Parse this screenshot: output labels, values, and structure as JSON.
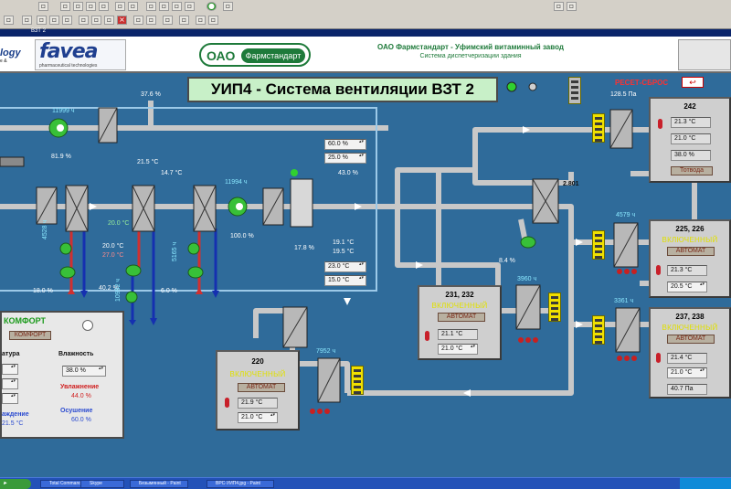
{
  "header": {
    "logo_left": "logy",
    "logo_left_sub": "e &",
    "logo_favea": "favea",
    "logo_favea_sub": "pharmaceutical technologies",
    "logo_pharm_prefix": "ОАО",
    "logo_pharm_name": "Фармстандарт",
    "title": "ОАО Фармстандарт - Уфимский витаминный завод",
    "subtitle": "Система диспетчеризации здания"
  },
  "window": {
    "title": "ВЗТ 2"
  },
  "banner": "УИП4 - Система вентиляции ВЗТ 2",
  "reset_label": "РЕСЕТ-СБРОС",
  "ahu": {
    "fan1_hours": "11999 ч",
    "fan1_pct": "81.9 %",
    "damper_pct": "37.6 %",
    "temp_top": "21.5 °C",
    "temp_mid": "14.7 °C",
    "fan2_hours": "11994 ч",
    "fan2_pct": "100.0 %",
    "heat1_temp": "20.0 °C",
    "heat1_ret_a": "20.0 °C",
    "heat1_ret_b": "27.0 °C",
    "valve1_pct": "18.0 %",
    "valve2_pct": "40.2 %",
    "valve3_pct": "6.0 %",
    "pump1_hours": "4528 ч",
    "pump2_hours": "10992 ч",
    "pump3_hours": "5165 ч",
    "humid_pct": "43.0 %",
    "humid_val": "17.8 %",
    "out_temp": "19.1 °C",
    "out_temp2": "19.5 °C",
    "set1": "60.0 %",
    "set2": "25.0 %",
    "set3": "23.0 °C",
    "set4": "15.0 °C"
  },
  "zones": {
    "z242": {
      "name": "242",
      "v1": "21.3 °C",
      "v2": "21.0 °C",
      "v3": "38.0 %",
      "mode": "Тотвода",
      "pressure": "128.5 Па"
    },
    "z225": {
      "name": "225, 226",
      "state": "ВКЛЮЧЕННЫЙ",
      "mode": "АВТОМАТ",
      "v1": "21.3 °C",
      "v2": "20.5 °C",
      "hours": "4579 ч"
    },
    "z231": {
      "name": "231, 232",
      "state": "ВКЛЮЧЕННЫЙ",
      "mode": "АВТОМАТ",
      "v1": "21.1 °C",
      "v2": "21.0 °C",
      "hours": "3960 ч"
    },
    "z237": {
      "name": "237, 238",
      "state": "ВКЛЮЧЕННЫЙ",
      "mode": "АВТОМАТ",
      "v1": "21.4 °C",
      "v2": "21.0 °C",
      "v3": "40.7 Па",
      "hours": "3361 ч"
    },
    "z220": {
      "name": "220",
      "state": "ВКЛЮЧЕННЫЙ",
      "mode": "АВТОМАТ",
      "v1": "21.9 °C",
      "v2": "21.0 °C",
      "hours": "7952 ч"
    }
  },
  "exhaust": {
    "id": "2.801",
    "pct": "8.4 %"
  },
  "comfort": {
    "title": "КОМФОРТ",
    "button": "КОМФОРТ",
    "temp_label": "атура",
    "humid_label": "Влажность",
    "humid_value": "38.0 %",
    "humidify_label": "Увлажнение",
    "humidify_value": "44.0 %",
    "cool_label": "аждение",
    "cool_value": "21.5 °C",
    "dehumid_label": "Осушение",
    "dehumid_value": "60.0 %"
  },
  "taskbar": {
    "items": [
      "Total Commander 7...",
      "Skype",
      "Безымянный - Paint",
      "ВРС-УИП4.jpg - Paint"
    ]
  },
  "colors": {
    "bg": "#2f6b9a",
    "pipe": "#c8c8c8",
    "mode_text": "#e0e000",
    "banner": "#c8f0c8"
  }
}
